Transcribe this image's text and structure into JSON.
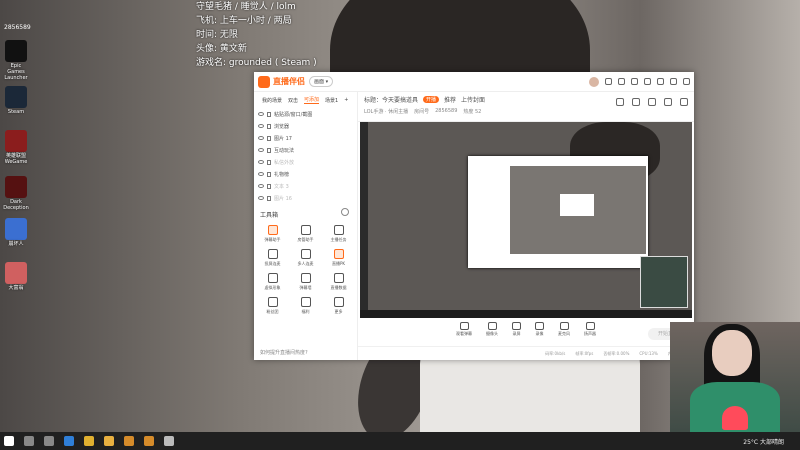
{
  "overlay": {
    "stream_id": "2856589",
    "lines": [
      "守望毛猪 / 睡觉人 / lolm",
      "飞机: 上车一小时 / 两局",
      "时间: 无限",
      "头像: 黄文新",
      "游戏名: grounded ( Steam )"
    ]
  },
  "desktop_icons": [
    {
      "label": "Epic Games Launcher",
      "color": "#111111",
      "icon": "epic-icon"
    },
    {
      "label": "Steam",
      "color": "#1b2838",
      "icon": "steam-icon"
    },
    {
      "label": "英雄联盟 WeGame",
      "color": "#8b1d1d",
      "icon": "game-icon"
    },
    {
      "label": "Dark Deception",
      "color": "#551111",
      "icon": "game-icon"
    },
    {
      "label": "崩坏人",
      "color": "#3b6fd1",
      "icon": "game-icon"
    },
    {
      "label": "大富翁",
      "color": "#d06060",
      "icon": "game-icon"
    }
  ],
  "window": {
    "brand": "直播伴侣",
    "dropdown": "画面 ▾",
    "left_tabs": [
      "我的场景",
      "双击",
      "可添加",
      "场景1",
      "+"
    ],
    "sources": [
      {
        "label": "粘贴源/窗口/截图",
        "dim": false
      },
      {
        "label": "浏览器",
        "dim": false
      },
      {
        "label": "图片 17",
        "dim": false
      },
      {
        "label": "互动玩法",
        "dim": false
      },
      {
        "label": "私信外放",
        "dim": true
      },
      {
        "label": "礼物榜",
        "dim": false
      },
      {
        "label": "文本 3",
        "dim": true
      },
      {
        "label": "图片 16",
        "dim": true
      }
    ],
    "tools_title": "工具箱",
    "tools": [
      {
        "label": "弹幕助手",
        "hot": true
      },
      {
        "label": "房管助手",
        "hot": false
      },
      {
        "label": "主播任务",
        "hot": false
      },
      {
        "label": "投屏连麦",
        "hot": false
      },
      {
        "label": "多人连麦",
        "hot": false
      },
      {
        "label": "直播PK",
        "hot": true
      },
      {
        "label": "虚拟形象",
        "hot": false
      },
      {
        "label": "弹幕墙",
        "hot": false
      },
      {
        "label": "直播数据",
        "hot": false
      },
      {
        "label": "粉丝团",
        "hot": false
      },
      {
        "label": "福利",
        "hot": false
      },
      {
        "label": "更多",
        "hot": false
      }
    ],
    "help": "如何提升直播间热度?",
    "header": {
      "title": "标题：今天要搞道具",
      "badge": "开播",
      "tag": "推荐",
      "upload": "上传封面",
      "meta": [
        "LOL手游 · 休闲主播",
        "房间号",
        "2856589",
        "热度 52"
      ]
    },
    "controls": [
      "观看弹幕",
      "摄像头",
      "录屏",
      "录像",
      "麦克风",
      "扬声器"
    ],
    "start_button": "开始直播",
    "status": [
      "码率:0kb/s",
      "帧率:0fps",
      "丢帧率:0.00%",
      "CPU:13%",
      "内存:25%"
    ]
  },
  "taskbar": {
    "weather": "25°C 大部晴朗",
    "time": "",
    "apps": [
      "start-icon",
      "search-icon",
      "taskview-icon",
      "edge-icon",
      "chrome-icon",
      "explorer-icon",
      "app-icon",
      "app-icon",
      "app-icon"
    ]
  }
}
